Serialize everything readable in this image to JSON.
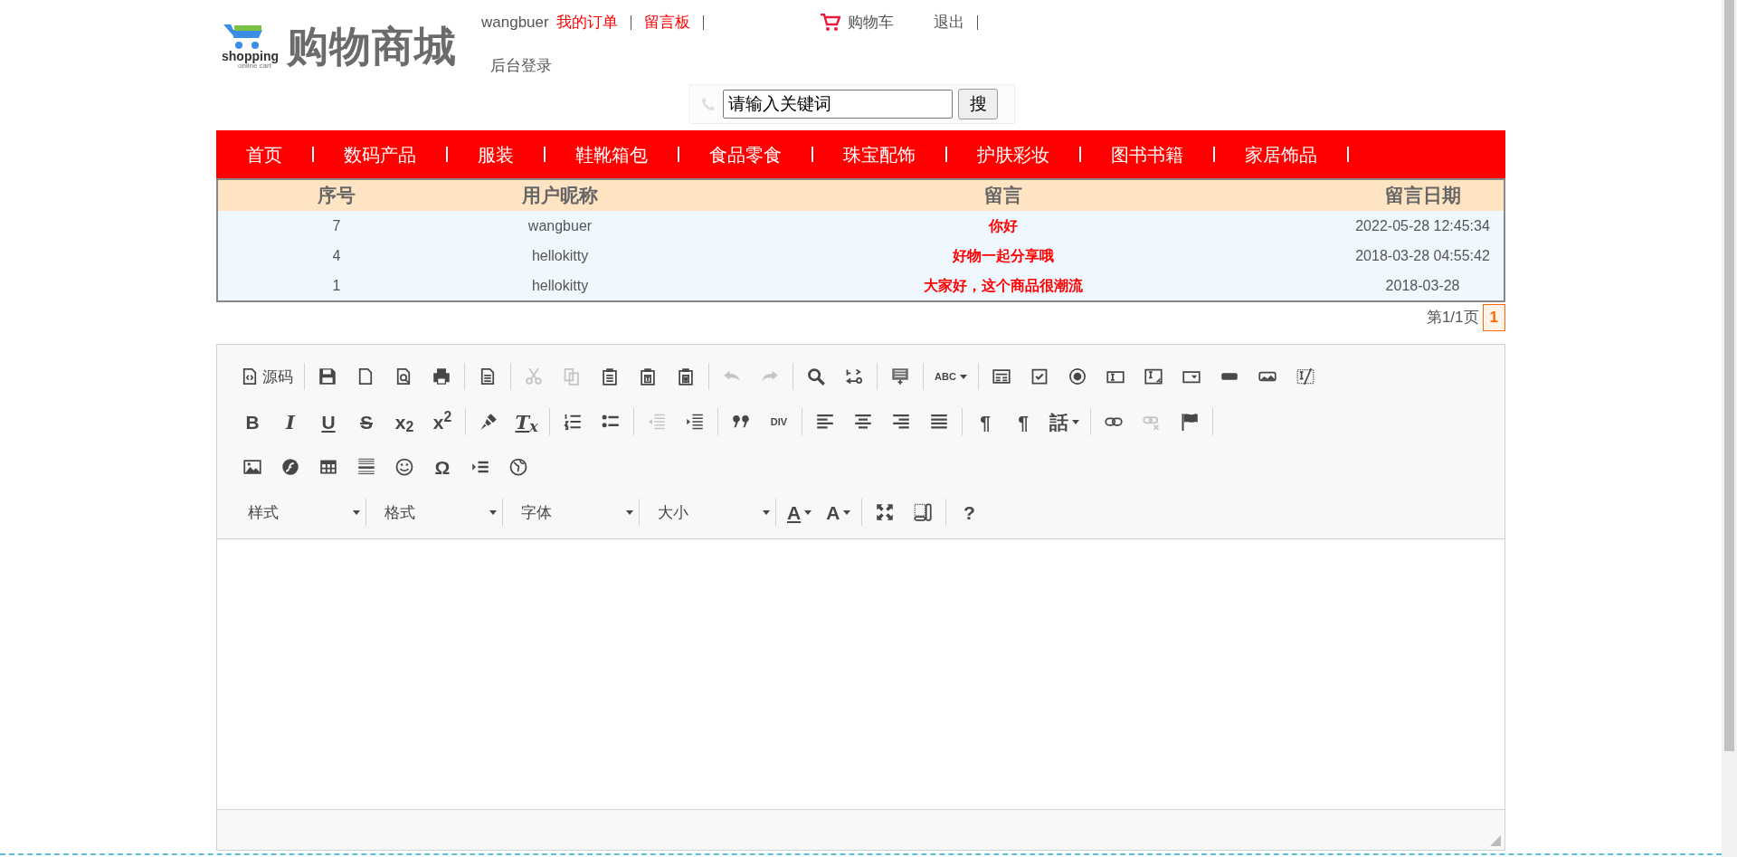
{
  "logo": {
    "tagline": "shopping",
    "subtagline": "online cart",
    "title": "购物商城"
  },
  "user_links": [
    {
      "label": "wangbuer",
      "kind": "user"
    },
    {
      "label": "我的订单",
      "kind": "link"
    },
    {
      "label": "留言板",
      "kind": "link"
    }
  ],
  "cart_link": {
    "label": "购物车"
  },
  "logout": {
    "label": "退出"
  },
  "admin_link": {
    "label": "后台登录"
  },
  "search": {
    "value": "请输入关键词",
    "button": "搜"
  },
  "nav": [
    "首页",
    "数码产品",
    "服装",
    "鞋靴箱包",
    "食品零食",
    "珠宝配饰",
    "护肤彩妆",
    "图书书籍",
    "家居饰品"
  ],
  "table": {
    "columns": [
      "序号",
      "用户昵称",
      "留言",
      "留言日期"
    ],
    "rows": [
      {
        "cells": [
          "7",
          "wangbuer",
          "你好",
          "2022-05-28 12:45:34"
        ]
      },
      {
        "cells": [
          "4",
          "hellokitty",
          "好物一起分享哦",
          "2018-03-28 04:55:42"
        ]
      },
      {
        "cells": [
          "1",
          "hellokitty",
          "大家好，这个商品很潮流",
          "2018-03-28"
        ]
      }
    ]
  },
  "pagination": {
    "summary": "第1/1页",
    "pages": [
      {
        "label": "1",
        "selected": true
      }
    ]
  },
  "editor": {
    "toolbar": [
      {
        "end_separator": false,
        "groups": [
          [
            {
              "kind": "source",
              "label": "源码",
              "disabled": false
            }
          ],
          [
            {
              "kind": "save",
              "disabled": false
            },
            {
              "kind": "newpage",
              "disabled": false
            },
            {
              "kind": "preview",
              "disabled": false
            },
            {
              "kind": "print",
              "disabled": false
            }
          ],
          [
            {
              "kind": "templates",
              "disabled": false
            }
          ],
          [
            {
              "kind": "cut",
              "disabled": true
            },
            {
              "kind": "copy",
              "disabled": true
            },
            {
              "kind": "paste",
              "disabled": false
            },
            {
              "kind": "pastetext",
              "disabled": false
            },
            {
              "kind": "pasteword",
              "disabled": false
            }
          ],
          [
            {
              "kind": "undo",
              "disabled": true
            },
            {
              "kind": "redo",
              "disabled": true
            }
          ],
          [
            {
              "kind": "find",
              "disabled": false
            },
            {
              "kind": "replace",
              "disabled": false
            }
          ],
          [
            {
              "kind": "selectall",
              "disabled": false
            }
          ],
          [
            {
              "kind": "spellcheck",
              "label": "ABC",
              "dropdown": true,
              "disabled": false
            }
          ],
          [
            {
              "kind": "form",
              "disabled": false
            },
            {
              "kind": "checkbox",
              "disabled": false
            },
            {
              "kind": "radio",
              "disabled": false
            },
            {
              "kind": "textfield",
              "disabled": false
            },
            {
              "kind": "textarea",
              "disabled": false
            },
            {
              "kind": "select",
              "disabled": false
            },
            {
              "kind": "button",
              "disabled": false
            },
            {
              "kind": "imagebutton",
              "disabled": false
            },
            {
              "kind": "hiddenfield",
              "disabled": false
            }
          ]
        ]
      },
      {
        "end_separator": true,
        "groups": [
          [
            {
              "kind": "bold",
              "label": "B",
              "disabled": false
            },
            {
              "kind": "italic",
              "label": "I",
              "disabled": false
            },
            {
              "kind": "underline",
              "label": "U",
              "disabled": false
            },
            {
              "kind": "strike",
              "label": "S",
              "disabled": false
            },
            {
              "kind": "subscript",
              "label": "x$_{2}$",
              "disabled": false
            },
            {
              "kind": "superscript",
              "label": "x$^{2}$",
              "disabled": false
            }
          ],
          [
            {
              "kind": "copyformat",
              "disabled": false
            },
            {
              "kind": "removeformat",
              "label": "T$_{x}$",
              "disabled": false
            }
          ],
          [
            {
              "kind": "numberedlist",
              "disabled": false
            },
            {
              "kind": "bulletedlist",
              "disabled": false
            }
          ],
          [
            {
              "kind": "outdent",
              "disabled": true
            },
            {
              "kind": "indent",
              "disabled": false
            }
          ],
          [
            {
              "kind": "blockquote",
              "disabled": false
            },
            {
              "kind": "creatediv",
              "label": "DIV",
              "disabled": false
            }
          ],
          [
            {
              "kind": "alignleft",
              "disabled": false
            },
            {
              "kind": "aligncenter",
              "disabled": false
            },
            {
              "kind": "alignright",
              "disabled": false
            },
            {
              "kind": "justify",
              "disabled": false
            }
          ],
          [
            {
              "kind": "ltr",
              "label": "¶",
              "disabled": false
            },
            {
              "kind": "rtl",
              "label": "¶",
              "disabled": false
            },
            {
              "kind": "language",
              "label": "話",
              "dropdown": true,
              "disabled": false
            }
          ],
          [
            {
              "kind": "link",
              "disabled": false
            },
            {
              "kind": "unlink",
              "disabled": true
            },
            {
              "kind": "anchor",
              "disabled": false
            }
          ]
        ]
      },
      {
        "end_separator": false,
        "groups": [
          [
            {
              "kind": "image",
              "disabled": false
            },
            {
              "kind": "flash",
              "disabled": false
            },
            {
              "kind": "table",
              "disabled": false
            },
            {
              "kind": "hr",
              "disabled": false
            },
            {
              "kind": "smiley",
              "disabled": false
            },
            {
              "kind": "specialchar",
              "label": "Ω",
              "disabled": false
            },
            {
              "kind": "pagebreak",
              "disabled": false
            },
            {
              "kind": "iframe",
              "disabled": false
            }
          ]
        ]
      },
      {
        "end_separator": false,
        "groups": [
          [
            {
              "kind": "combo",
              "label": "样式",
              "disabled": false
            },
            {
              "kind": "combo",
              "label": "格式",
              "disabled": false
            },
            {
              "kind": "combo",
              "label": "字体",
              "disabled": false
            },
            {
              "kind": "combo",
              "label": "大小",
              "disabled": false
            }
          ],
          [
            {
              "kind": "textcolor",
              "label": "A",
              "dropdown": true,
              "disabled": false
            },
            {
              "kind": "bgcolor",
              "label": "A",
              "dropdown": true,
              "disabled": false
            }
          ],
          [
            {
              "kind": "maximize",
              "disabled": false
            },
            {
              "kind": "showblocks",
              "disabled": false
            }
          ],
          [
            {
              "kind": "about",
              "label": "?",
              "disabled": false
            }
          ]
        ]
      }
    ]
  }
}
